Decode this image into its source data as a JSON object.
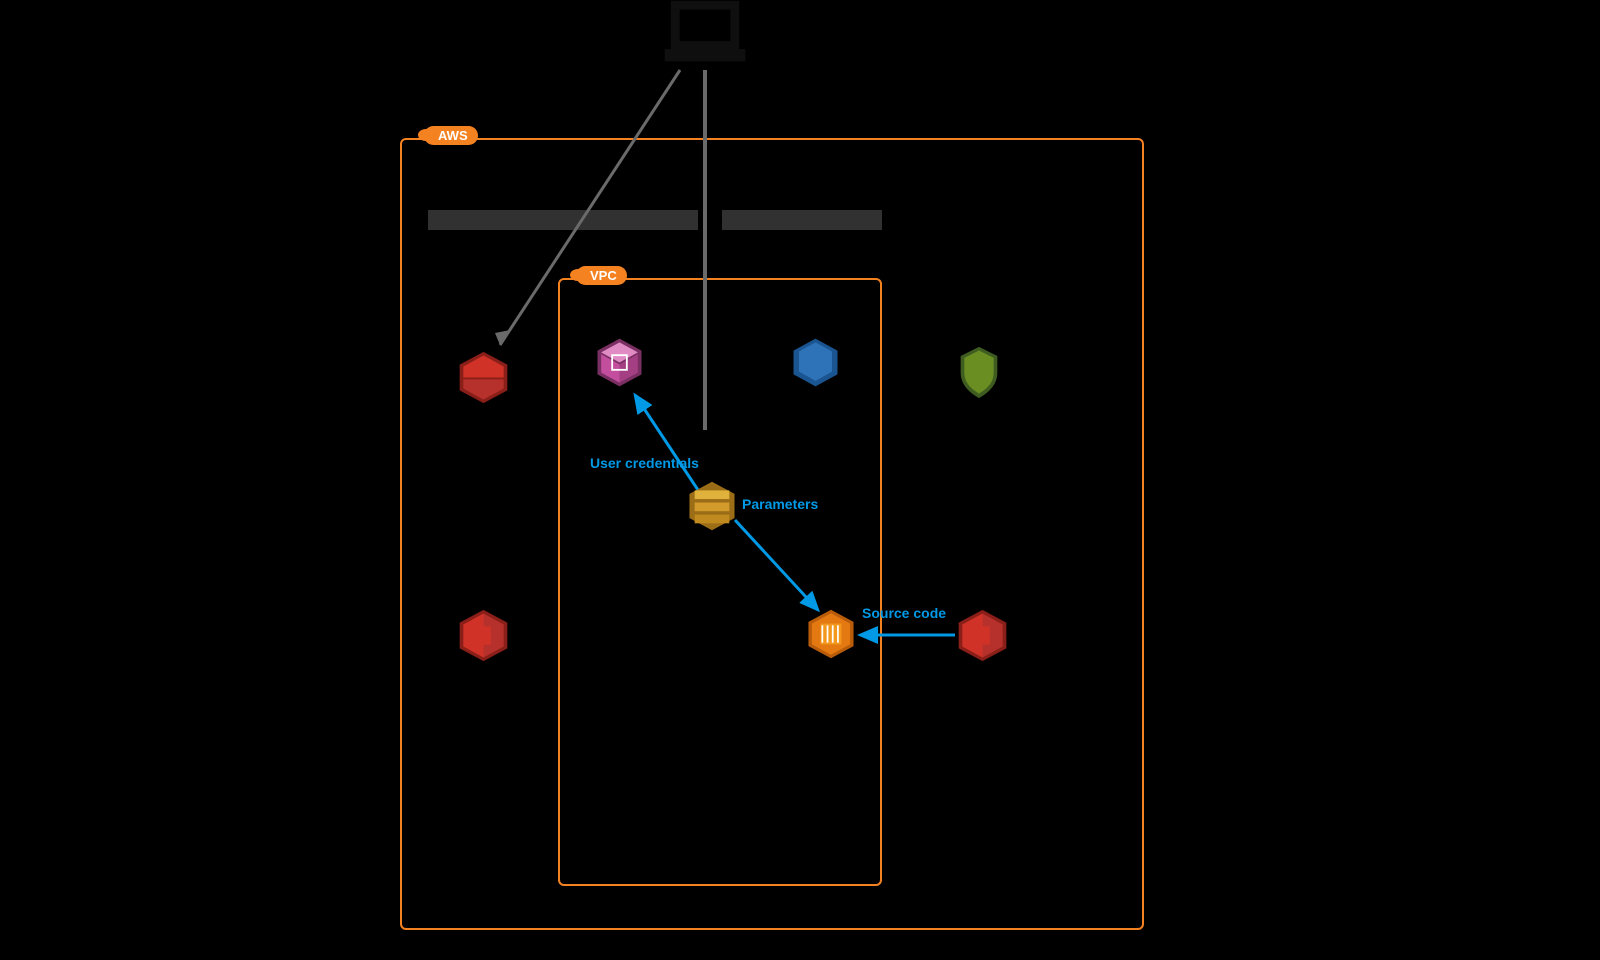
{
  "containers": {
    "aws_label": "AWS",
    "vpc_label": "VPC"
  },
  "flows": {
    "user_credentials": "User credentials",
    "parameters": "Parameters",
    "source_code": "Source code"
  },
  "annotations": {
    "left_pipeline": "",
    "right_pipeline": ""
  },
  "icons": {
    "laptop": "laptop",
    "codebuild": "codebuild",
    "codepipeline_left": "codepipeline",
    "codepipeline_right": "codepipeline",
    "ecr": "ecr",
    "glacier": "glacier",
    "pinpoint": "pinpoint",
    "sqs": "sqs",
    "ec2": "ec2"
  },
  "colors": {
    "orange": "#f58220",
    "blue": "#0099e5",
    "dark_red": "#b7312c",
    "light_red": "#d13227",
    "pink": "#c24e9d",
    "navy": "#2e73b8",
    "olive": "#6b8e23",
    "gold": "#d29b2c",
    "orange_ec2": "#e47911"
  }
}
